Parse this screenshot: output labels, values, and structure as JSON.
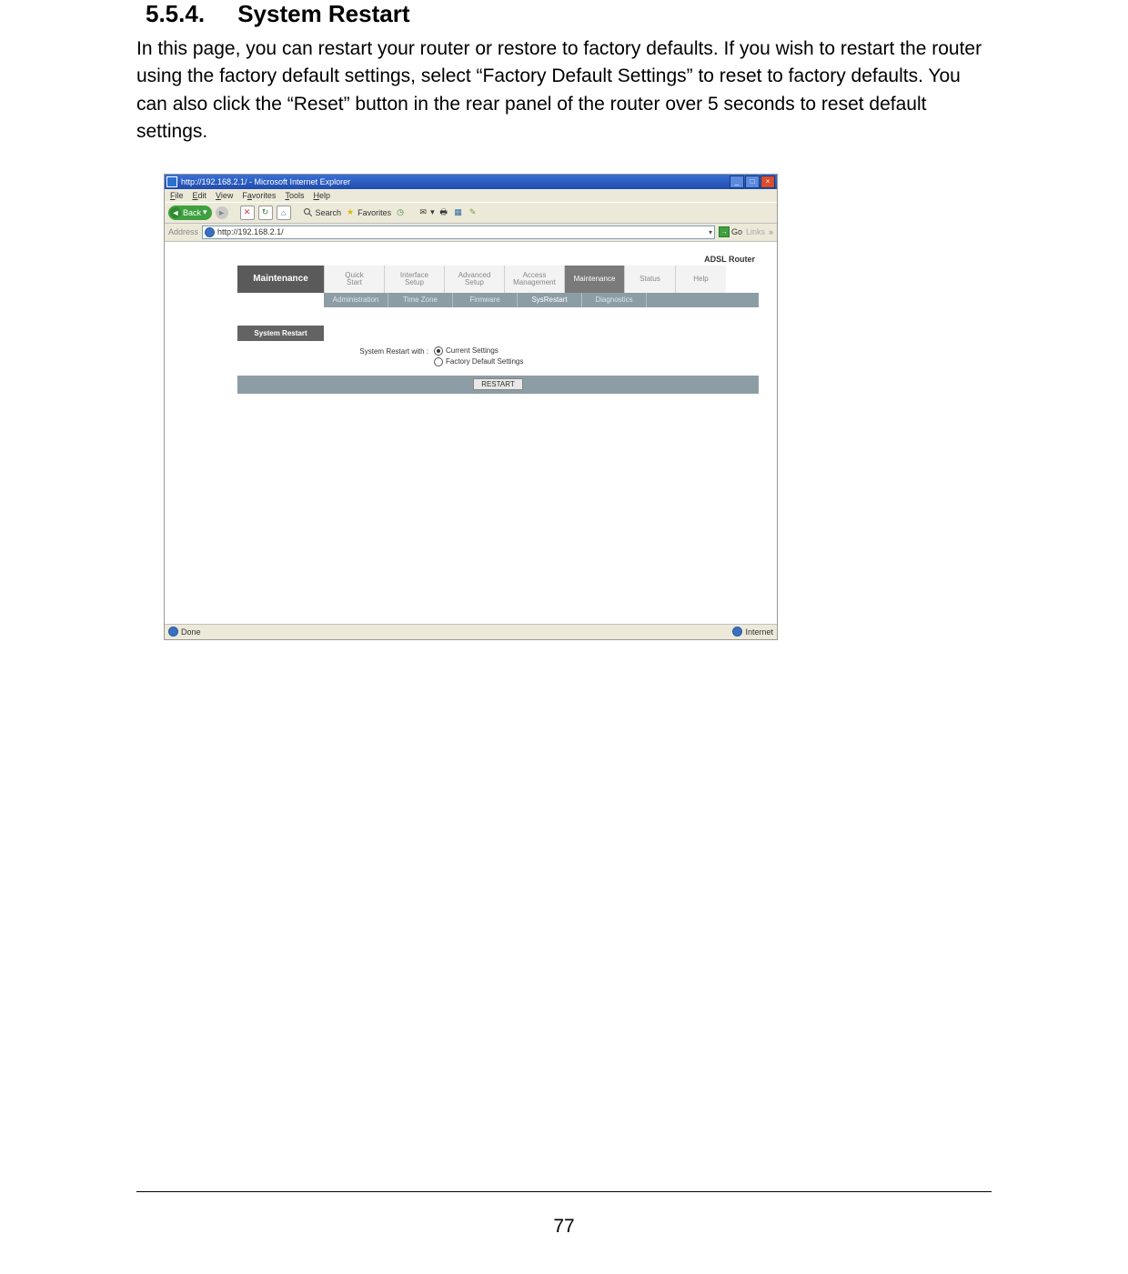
{
  "section": {
    "number": "5.5.4.",
    "title": "System Restart"
  },
  "body_text": "In this page, you can restart your router or restore to factory defaults. If you wish to restart the router using the factory default settings, select “Factory Default Settings” to reset to factory defaults. You can also click the “Reset” button in the rear panel of the router over 5 seconds to reset default settings.",
  "page_number": "77",
  "ie": {
    "title": "http://192.168.2.1/ - Microsoft Internet Explorer",
    "menu": {
      "file": "File",
      "edit": "Edit",
      "view": "View",
      "favorites": "Favorites",
      "tools": "Tools",
      "help": "Help"
    },
    "toolbar": {
      "back": "Back",
      "search": "Search",
      "favorites": "Favorites"
    },
    "address": {
      "label": "Address",
      "url": "http://192.168.2.1/",
      "go": "Go",
      "links": "Links"
    },
    "status": {
      "left": "Done",
      "right": "Internet"
    }
  },
  "router": {
    "product": "ADSL Router",
    "main_tab": "Maintenance",
    "tabs": {
      "quick_start_l1": "Quick",
      "quick_start_l2": "Start",
      "interface_l1": "Interface",
      "interface_l2": "Setup",
      "advanced_l1": "Advanced",
      "advanced_l2": "Setup",
      "access_l1": "Access",
      "access_l2": "Management",
      "maintenance": "Maintenance",
      "status": "Status",
      "help": "Help"
    },
    "subtabs": {
      "admin": "Administration",
      "timezone": "Time Zone",
      "firmware": "Firmware",
      "sysrestart": "SysRestart",
      "diagnostics": "Diagnostics"
    },
    "section_label": "System Restart",
    "form": {
      "label": "System Restart with :",
      "opt_current": "Current Settings",
      "opt_factory": "Factory Default Settings"
    },
    "restart_button": "RESTART"
  }
}
